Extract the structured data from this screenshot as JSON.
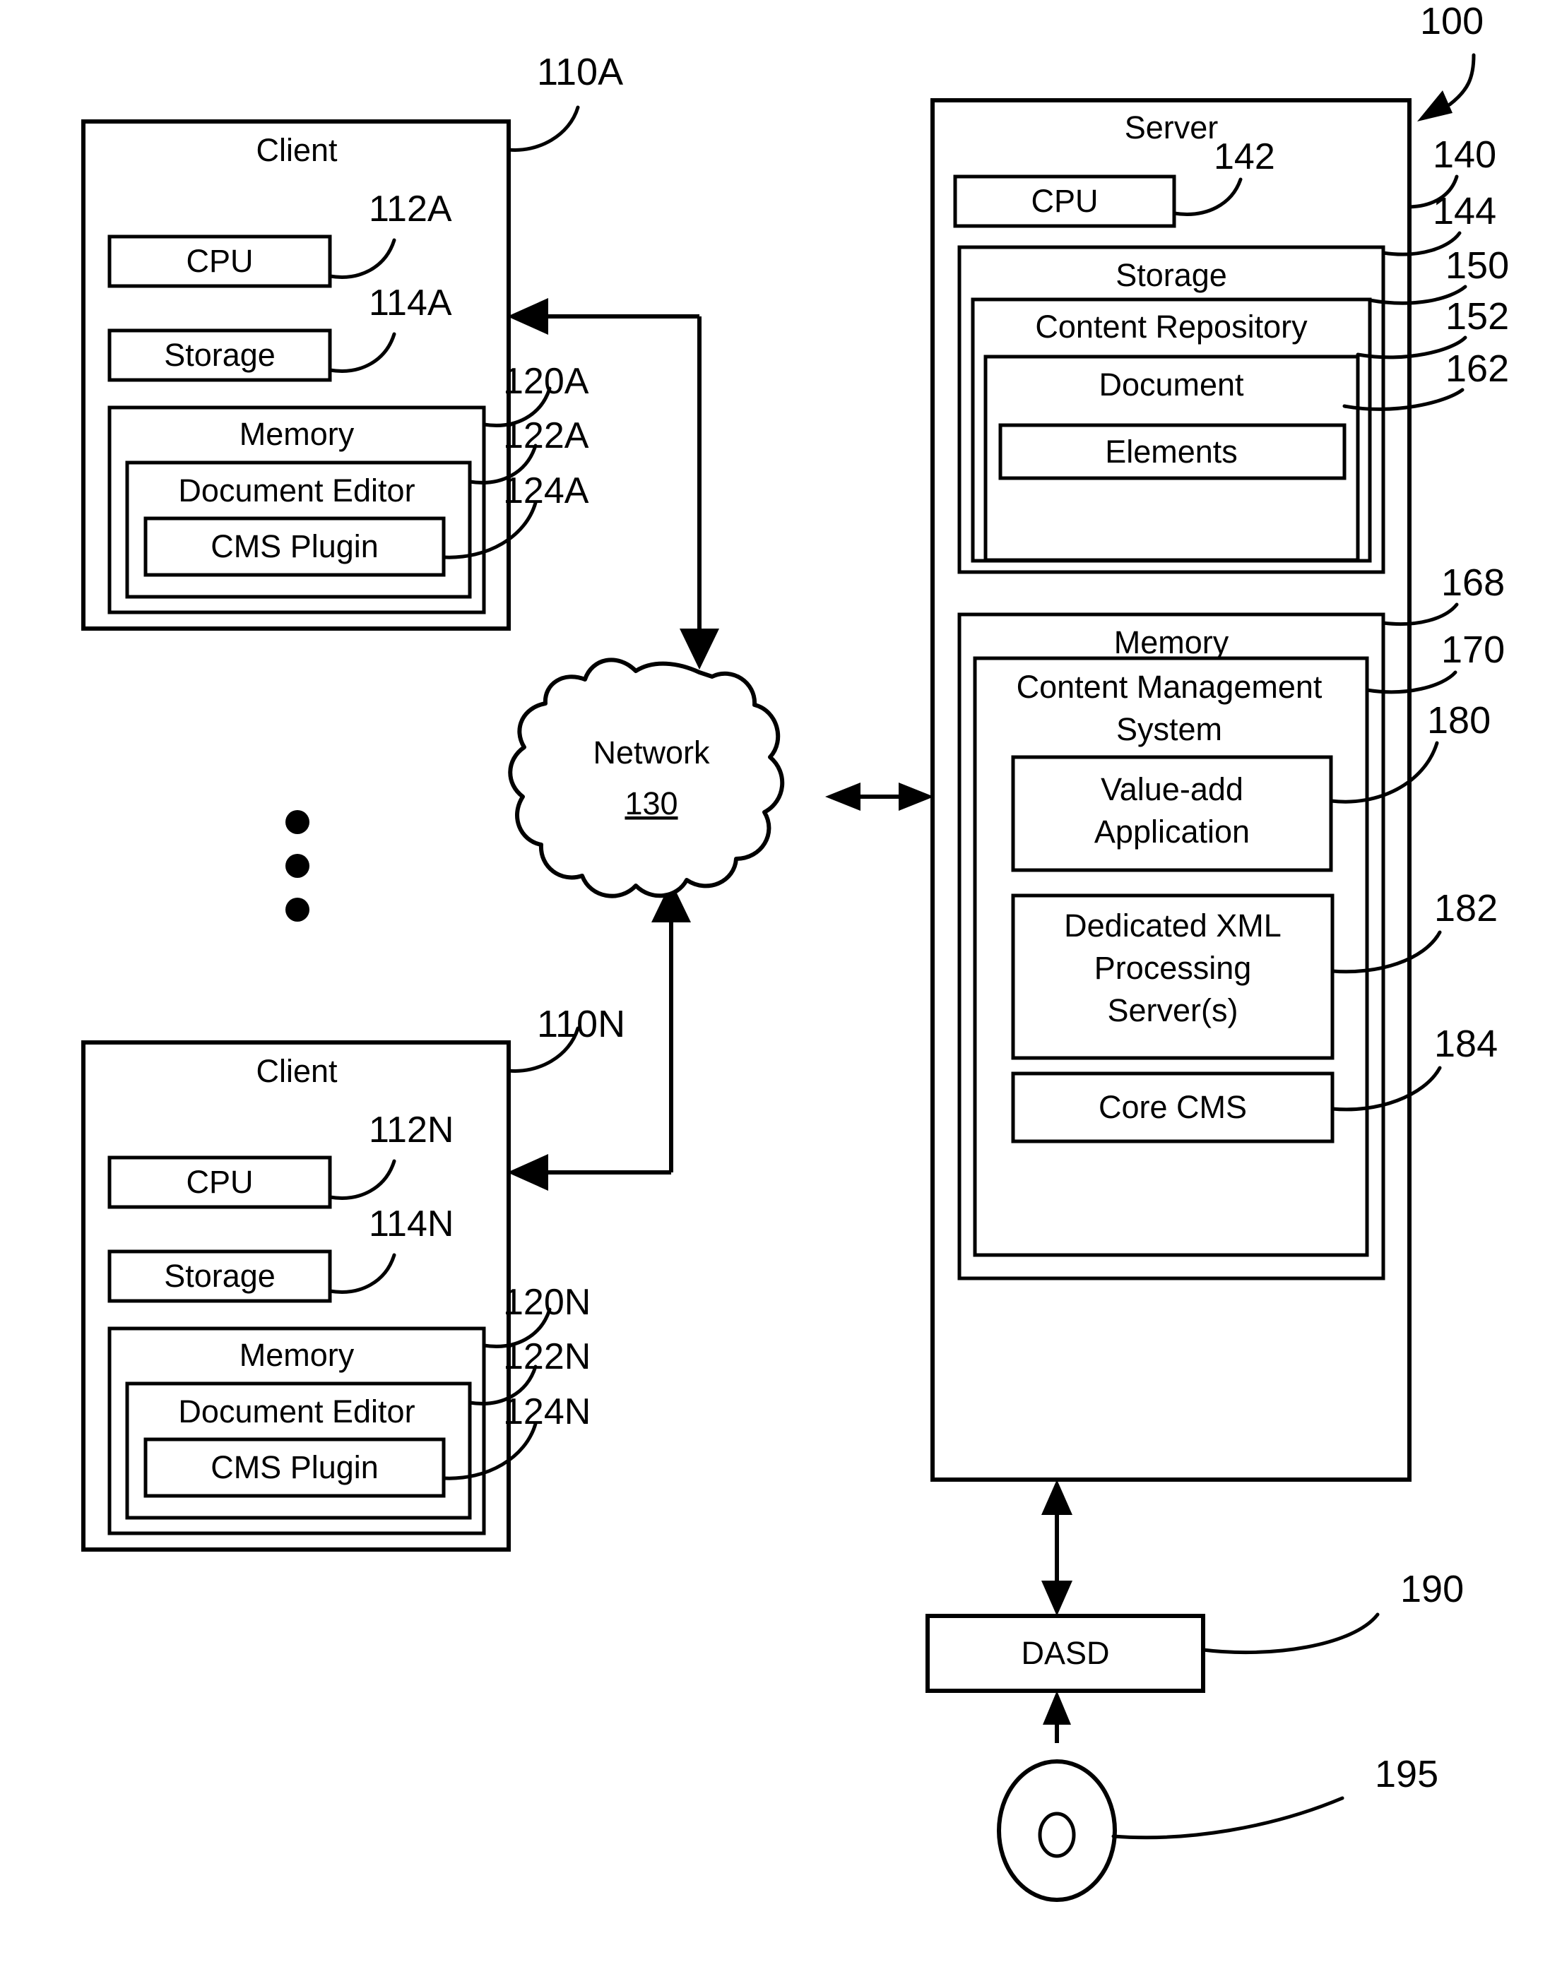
{
  "figure": {
    "system_ref": "100",
    "clients": [
      {
        "title": "Client",
        "ref": "110A",
        "cpu": {
          "label": "CPU",
          "ref": "112A"
        },
        "storage": {
          "label": "Storage",
          "ref": "114A"
        },
        "memory": {
          "label": "Memory",
          "ref": "120A"
        },
        "document_editor": {
          "label": "Document Editor",
          "ref": "122A"
        },
        "cms_plugin": {
          "label": "CMS Plugin",
          "ref": "124A"
        }
      },
      {
        "title": "Client",
        "ref": "110N",
        "cpu": {
          "label": "CPU",
          "ref": "112N"
        },
        "storage": {
          "label": "Storage",
          "ref": "114N"
        },
        "memory": {
          "label": "Memory",
          "ref": "120N"
        },
        "document_editor": {
          "label": "Document Editor",
          "ref": "122N"
        },
        "cms_plugin": {
          "label": "CMS Plugin",
          "ref": "124N"
        }
      }
    ],
    "network": {
      "label": "Network",
      "ref": "130"
    },
    "server": {
      "title": "Server",
      "ref": "140",
      "cpu": {
        "label": "CPU",
        "ref": "142"
      },
      "storage": {
        "label": "Storage",
        "ref": "144"
      },
      "content_repository": {
        "label": "Content Repository",
        "ref": "150"
      },
      "document": {
        "label": "Document",
        "ref": "152"
      },
      "elements": {
        "label": "Elements",
        "ref": "162"
      },
      "memory": {
        "label": "Memory",
        "ref": "168"
      },
      "cms": {
        "label_line1": "Content Management",
        "label_line2": "System",
        "ref": "170"
      },
      "value_add": {
        "label_line1": "Value-add",
        "label_line2": "Application",
        "ref": "180"
      },
      "xml_server": {
        "label_line1": "Dedicated XML",
        "label_line2": "Processing",
        "label_line3": "Server(s)",
        "ref": "182"
      },
      "core_cms": {
        "label": "Core CMS",
        "ref": "184"
      }
    },
    "dasd": {
      "label": "DASD",
      "ref": "190"
    },
    "disc": {
      "ref": "195"
    },
    "ellipsis_icon": "vertical-ellipsis-icon"
  }
}
